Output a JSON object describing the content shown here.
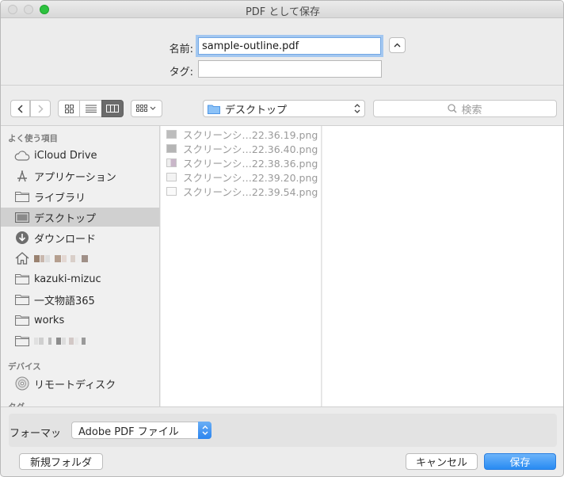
{
  "window": {
    "title": "PDF として保存"
  },
  "save_form": {
    "name_label": "名前:",
    "name_value": "sample-outline.pdf",
    "tag_label": "タグ:",
    "tag_value": ""
  },
  "toolbar": {
    "location": "デスクトップ",
    "search_placeholder": "検索",
    "view_icons": [
      "icon-view-icon",
      "list-view-icon",
      "column-view-icon"
    ],
    "active_view": "column-view-icon"
  },
  "sidebar": {
    "favorites_header": "よく使う項目",
    "favorites": [
      {
        "label": "iCloud Drive",
        "icon": "cloud-icon"
      },
      {
        "label": "アプリケーション",
        "icon": "applications-icon"
      },
      {
        "label": "ライブラリ",
        "icon": "folder-icon"
      },
      {
        "label": "デスクトップ",
        "icon": "desktop-icon",
        "selected": true
      },
      {
        "label": "ダウンロード",
        "icon": "download-icon"
      },
      {
        "label": "",
        "icon": "home-icon",
        "redacted": true
      },
      {
        "label": "kazuki-mizuc",
        "icon": "folder-icon"
      },
      {
        "label": "一文物語365",
        "icon": "folder-icon"
      },
      {
        "label": "works",
        "icon": "folder-icon"
      },
      {
        "label": "",
        "icon": "folder-icon",
        "redacted": true
      }
    ],
    "devices_header": "デバイス",
    "devices": [
      {
        "label": "リモートディスク",
        "icon": "remote-disc-icon"
      }
    ],
    "tags_header": "タグ"
  },
  "files": [
    {
      "name": "スクリーンシ…22.36.19.png"
    },
    {
      "name": "スクリーンシ…22.36.40.png"
    },
    {
      "name": "スクリーンシ…22.38.36.png"
    },
    {
      "name": "スクリーンシ…22.39.20.png"
    },
    {
      "name": "スクリーンシ…22.39.54.png"
    }
  ],
  "format": {
    "label": "フォーマッ",
    "selected": "Adobe PDF ファイル"
  },
  "buttons": {
    "new_folder": "新規フォルダ",
    "cancel": "キャンセル",
    "save": "保存"
  },
  "colors": {
    "accent": "#288bf2",
    "selection": "#d0d0d0",
    "folder_tint": "#5fa7ef"
  }
}
